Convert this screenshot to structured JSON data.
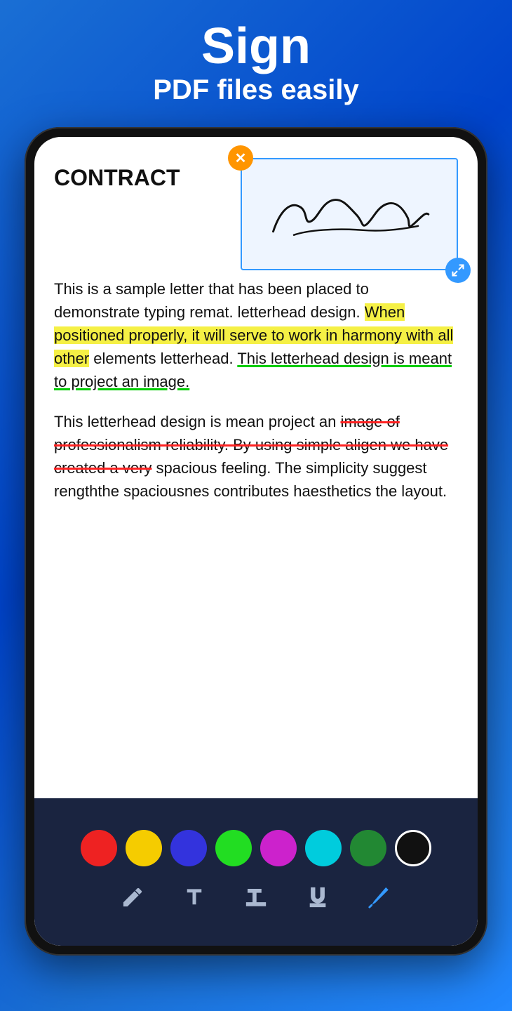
{
  "header": {
    "title": "Sign",
    "subtitle": "PDF files easily"
  },
  "signature": {
    "close_label": "✕",
    "resize_label": "↙"
  },
  "document": {
    "title": "CONTRACT",
    "paragraph1_normal1": "This is a sample letter that has been placed to demonstrate typing remat. letterhead design. ",
    "paragraph1_highlighted": "When positioned properly, it will serve to work in harmony with all other",
    "paragraph1_normal2": " elements letterhead. ",
    "paragraph1_underlined": "This letterhead design is meant to project an image.",
    "paragraph2_normal1": "This letterhead design is mean project an ",
    "paragraph2_strikethrough": "image of professionalism reliability. By using simple aligen we have created a very",
    "paragraph2_normal2": " spacious feeling. The simplicity suggest rengththe spaciousnes contributes haesthetics the layout."
  },
  "toolbar": {
    "colors": [
      {
        "name": "red",
        "hex": "#ee2222"
      },
      {
        "name": "yellow",
        "hex": "#f5cc00"
      },
      {
        "name": "blue",
        "hex": "#3333dd"
      },
      {
        "name": "green",
        "hex": "#22dd22"
      },
      {
        "name": "purple",
        "hex": "#cc22cc"
      },
      {
        "name": "cyan",
        "hex": "#00ccdd"
      },
      {
        "name": "dark-green",
        "hex": "#228833"
      },
      {
        "name": "black",
        "hex": "#111111"
      }
    ],
    "tools": [
      {
        "name": "pencil",
        "label": "✏"
      },
      {
        "name": "text",
        "label": "T"
      },
      {
        "name": "text-bold",
        "label": "T̈"
      },
      {
        "name": "text-underline",
        "label": "T"
      },
      {
        "name": "pen",
        "label": "pen"
      }
    ]
  }
}
